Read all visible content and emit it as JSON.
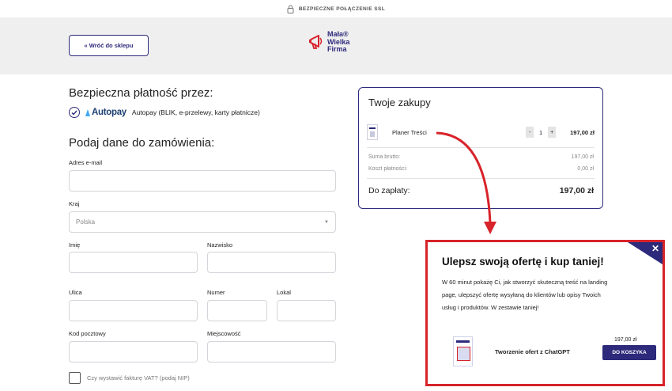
{
  "ssl": {
    "text": "BEZPIECZNE POŁĄCZENIE SSL",
    "icon": "lock-icon"
  },
  "header": {
    "back_label": "« Wróć do sklepu",
    "logo": {
      "line1": "Mała®",
      "line2": "Wielka",
      "line3": "Firma",
      "icon": "megaphone-icon"
    }
  },
  "payment": {
    "title": "Bezpieczna płatność przez:",
    "provider_logo": "Autopay",
    "provider_desc": "Autopay (BLIK, e-przelewy, karty płatnicze)"
  },
  "form": {
    "title": "Podaj dane do zamówienia:",
    "email_label": "Adres e-mail",
    "country_label": "Kraj",
    "country_value": "Polska",
    "first_name_label": "Imię",
    "last_name_label": "Nazwisko",
    "street_label": "Ulica",
    "number_label": "Numer",
    "apartment_label": "Lokal",
    "postal_label": "Kod pocztowy",
    "city_label": "Miejscowość",
    "vat_label": "Czy wystawić fakturę VAT? (podaj NIP)"
  },
  "cart": {
    "title": "Twoje zakupy",
    "item": {
      "name": "Planer Treści",
      "qty": "1",
      "minus": "-",
      "plus": "+",
      "price": "197,00 zł"
    },
    "gross_label": "Suma brutto:",
    "gross_value": "197,00 zł",
    "fee_label": "Koszt płatności:",
    "fee_value": "0,00 zł",
    "total_label": "Do zapłaty:",
    "total_value": "197,00 zł"
  },
  "upsell": {
    "close": "✕",
    "title": "Ulepsz swoją ofertę i kup taniej!",
    "text": "W 60 minut pokażę Ci, jak stworzyć skuteczną treść na landing page, ulepszyć ofertę wysyłaną do klientów lub opisy Twoich usług i produktów. W zestawie taniej!",
    "product_name": "Tworzenie ofert z ChatGPT",
    "price": "197,00 zł",
    "button": "DO KOSZYKA"
  },
  "colors": {
    "brand": "#2d2a7b",
    "accent_red": "#d8232a",
    "header_bg": "#efefef"
  }
}
